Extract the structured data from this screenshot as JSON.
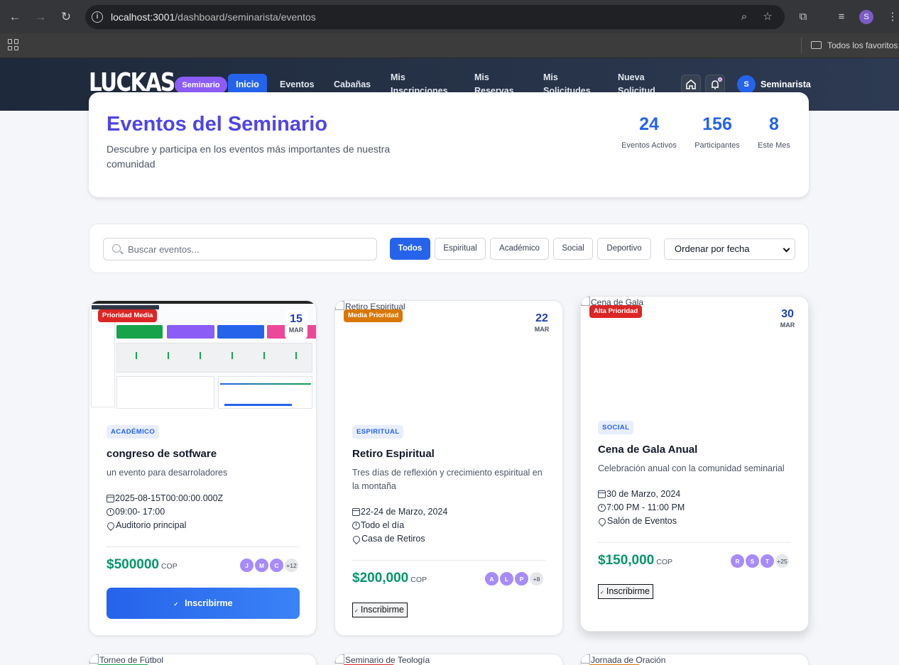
{
  "browser": {
    "url_host": "localhost:3001",
    "url_path": "/dashboard/seminarista/eventos",
    "bookmarks_label": "Todos los favoritos",
    "profile_initial": "S"
  },
  "nav": {
    "logo": "LUCKAS",
    "role_badge": "Seminario",
    "items": [
      {
        "label": "Inicio"
      },
      {
        "label": "Eventos"
      },
      {
        "label": "Cabañas"
      },
      {
        "label": "Mis Inscripciones"
      },
      {
        "label": "Mis Reservas"
      },
      {
        "label": "Mis Solicitudes"
      },
      {
        "label": "Nueva Solicitud"
      }
    ],
    "user_initial": "S",
    "user_name": "Seminarista"
  },
  "hero": {
    "title": "Eventos del Seminario",
    "subtitle": "Descubre y participa en los eventos más importantes de nuestra comunidad",
    "stats": [
      {
        "value": "24",
        "label": "Eventos Activos"
      },
      {
        "value": "156",
        "label": "Participantes"
      },
      {
        "value": "8",
        "label": "Este Mes"
      }
    ]
  },
  "filters": {
    "search_placeholder": "Buscar eventos...",
    "categories": [
      "Todos",
      "Espiritual",
      "Académico",
      "Social",
      "Deportivo"
    ],
    "sort_value": "Ordenar por fecha"
  },
  "events": [
    {
      "priority": "Prioridad Media",
      "priority_color": "#dc2626",
      "day": "15",
      "month": "MAR",
      "category": "ACADÉMICO",
      "title": "congreso de sotfware",
      "description": "un evento para desarroladores",
      "date": "2025-08-15T00:00:00.000Z",
      "time": "09:00- 17:00",
      "location": "Auditorio principal",
      "price": "$500000",
      "currency": "COP",
      "avatars": [
        "J",
        "M",
        "C"
      ],
      "more": "+12",
      "button": "Inscribirme"
    },
    {
      "image_alt": "Retiro Espiritual",
      "priority": "Media Prioridad",
      "priority_color": "#d97706",
      "day": "22",
      "month": "MAR",
      "category": "ESPIRITUAL",
      "title": "Retiro Espiritual",
      "description": "Tres días de reflexión y crecimiento espiritual en la montaña",
      "date": "22-24 de Marzo, 2024",
      "time": "Todo el día",
      "location": "Casa de Retiros",
      "price": "$200,000",
      "currency": "COP",
      "avatars": [
        "A",
        "L",
        "P"
      ],
      "more": "+8",
      "button": "Inscribirme"
    },
    {
      "image_alt": "Cena de Gala",
      "priority": "Alta Prioridad",
      "priority_color": "#dc2626",
      "day": "30",
      "month": "MAR",
      "category": "SOCIAL",
      "title": "Cena de Gala Anual",
      "description": "Celebración anual con la comunidad seminarial",
      "date": "30 de Marzo, 2024",
      "time": "7:00 PM - 11:00 PM",
      "location": "Salón de Eventos",
      "price": "$150,000",
      "currency": "COP",
      "avatars": [
        "R",
        "S",
        "T"
      ],
      "more": "+25",
      "button": "Inscribirme"
    }
  ],
  "next_row_alts": [
    "Torneo de Fútbol",
    "Seminario de Teología",
    "Jornada de Oración"
  ]
}
